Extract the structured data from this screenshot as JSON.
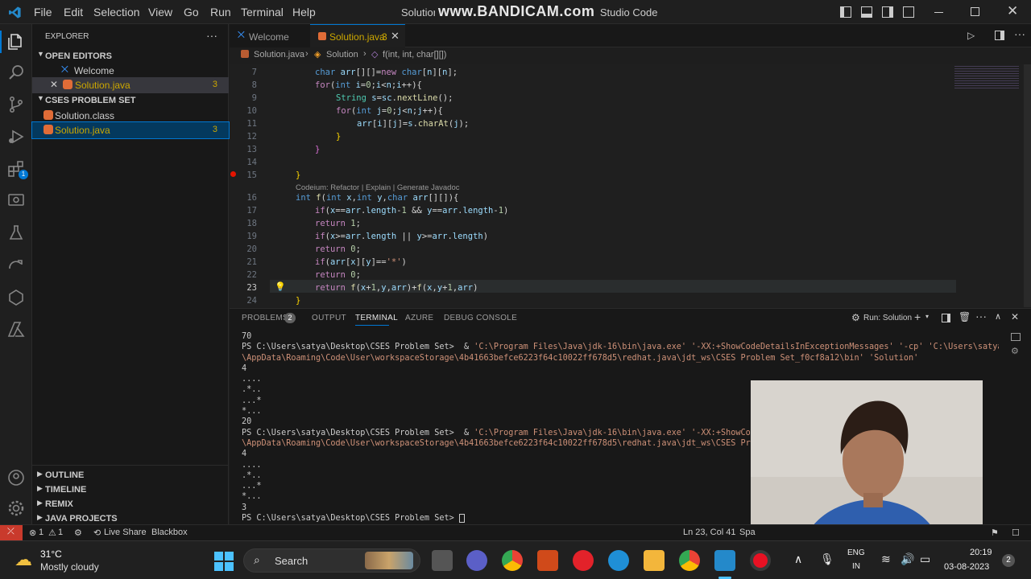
{
  "titlebar": {
    "menus": [
      "File",
      "Edit",
      "Selection",
      "View",
      "Go",
      "Run",
      "Terminal",
      "Help"
    ],
    "window_title": "Solution.java - CSES Problem Set - Visual Studio Code",
    "watermark": "www.BANDICAM.com"
  },
  "sidebar": {
    "explorer_title": "EXPLORER",
    "open_editors_label": "OPEN EDITORS",
    "open_editors": [
      {
        "name": "Welcome",
        "badge": ""
      },
      {
        "name": "Solution.java",
        "badge": "3"
      }
    ],
    "folder_label": "CSES PROBLEM SET",
    "files": [
      {
        "name": "Solution.class",
        "badge": ""
      },
      {
        "name": "Solution.java",
        "badge": "3"
      }
    ],
    "bottom_sections": [
      "OUTLINE",
      "TIMELINE",
      "REMIX",
      "JAVA PROJECTS"
    ]
  },
  "tabs": [
    {
      "label": "Welcome",
      "badge": ""
    },
    {
      "label": "Solution.java",
      "badge": "3"
    }
  ],
  "breadcrumb": [
    "Solution.java",
    "Solution",
    "f(int, int, char[][])"
  ],
  "editor": {
    "codelens": "Codeium: Refactor | Explain | Generate Javadoc",
    "lines": [
      {
        "n": "7",
        "text": "    char arr[][]=new char[n][n];"
      },
      {
        "n": "8",
        "text": "    for(int i=0;i<n;i++){"
      },
      {
        "n": "9",
        "text": "        String s=sc.nextLine();"
      },
      {
        "n": "10",
        "text": "        for(int j=0;j<n;j++){"
      },
      {
        "n": "11",
        "text": "            arr[i][j]=s.charAt(j);"
      },
      {
        "n": "12",
        "text": "        }"
      },
      {
        "n": "13",
        "text": "    }"
      },
      {
        "n": "14",
        "text": ""
      },
      {
        "n": "15",
        "text": "}"
      },
      {
        "n": "16",
        "text": "int f(int x,int y,char arr[][]){"
      },
      {
        "n": "17",
        "text": "    if(x==arr.length-1 && y==arr.length-1)"
      },
      {
        "n": "18",
        "text": "    return 1;"
      },
      {
        "n": "19",
        "text": "    if(x>=arr.length || y>=arr.length)"
      },
      {
        "n": "20",
        "text": "    return 0;"
      },
      {
        "n": "21",
        "text": "    if(arr[x][y]=='*')"
      },
      {
        "n": "22",
        "text": "    return 0;"
      },
      {
        "n": "23",
        "text": "    return f(x+1,y,arr)+f(x,y+1,arr)"
      },
      {
        "n": "24",
        "text": "}"
      }
    ]
  },
  "panel": {
    "tabs": [
      "PROBLEMS",
      "OUTPUT",
      "TERMINAL",
      "AZURE",
      "DEBUG CONSOLE"
    ],
    "problems_count": "2",
    "run_label": "Run: Solution",
    "terminal_lines": [
      "70",
      "PS C:\\Users\\satya\\Desktop\\CSES Problem Set>  & 'C:\\Program Files\\Java\\jdk-16\\bin\\java.exe' '-XX:+ShowCodeDetailsInExceptionMessages' '-cp' 'C:\\Users\\satya",
      "\\AppData\\Roaming\\Code\\User\\workspaceStorage\\4b41663befce6223f64c10022ff678d5\\redhat.java\\jdt_ws\\CSES Problem Set_f0cf8a12\\bin' 'Solution'",
      "4",
      "....",
      ".*..",
      "...*",
      "*...",
      "20",
      "PS C:\\Users\\satya\\Desktop\\CSES Problem Set>  & 'C:\\Program Files\\Java\\jdk-16\\bin\\java.exe' '-XX:+ShowCod",
      "\\AppData\\Roaming\\Code\\User\\workspaceStorage\\4b41663befce6223f64c10022ff678d5\\redhat.java\\jdt_ws\\CSES Prob",
      "4",
      "....",
      ".*..",
      "...*",
      "*...",
      "3",
      "PS C:\\Users\\satya\\Desktop\\CSES Problem Set> "
    ]
  },
  "statusbar": {
    "errors": "1",
    "warnings": "1",
    "live_share": "Live Share",
    "blackbox": "Blackbox",
    "position": "Ln 23, Col 41",
    "spaces": "Spa"
  },
  "taskbar": {
    "temperature": "31°C",
    "weather": "Mostly cloudy",
    "search": "Search",
    "lang_top": "ENG",
    "lang_bottom": "IN",
    "time": "20:19",
    "date": "03-08-2023",
    "notifications": "2"
  },
  "colors": {
    "accent": "#0078d4",
    "warning": "#cca700",
    "error": "#f14c4c"
  }
}
